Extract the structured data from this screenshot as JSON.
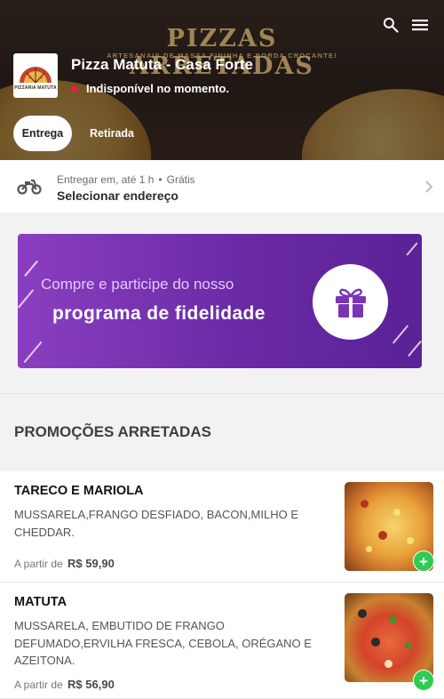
{
  "hero": {
    "brand": "PIZZAS ARRETADAS",
    "tagline": "ARTESANAIS DE MASSA FININHA E BORDA CROCANTE!"
  },
  "store": {
    "logo_text": "PIZZARIA MATUTA",
    "name": "Pizza Matuta - Casa Forte",
    "status": "Indisponível no momento."
  },
  "tabs": [
    {
      "label": "Entrega",
      "active": true
    },
    {
      "label": "Retirada",
      "active": false
    }
  ],
  "delivery": {
    "line1": "Entregar em, até 1 h",
    "separator": "•",
    "fee": "Grátis",
    "address_action": "Selecionar endereço"
  },
  "banner": {
    "line1": "Compre e participe do nosso",
    "line2": "programa de fidelidade"
  },
  "section": {
    "title": "PROMOÇÕES ARRETADAS"
  },
  "products": [
    {
      "name": "TARECO E MARIOLA",
      "description": "MUSSARELA,FRANGO DESFIADO, BACON,MILHO E CHEDDAR.",
      "price_prefix": "A partir de",
      "price": "R$ 59,90"
    },
    {
      "name": "MATUTA",
      "description": "MUSSARELA, EMBUTIDO DE FRANGO DEFUMADO,ERVILHA FRESCA, CEBOLA, ORÉGANO E AZEITONA.",
      "price_prefix": "A partir de",
      "price": "R$ 56,90"
    }
  ],
  "colors": {
    "status_dot": "#e0243c",
    "banner_purple": "#7a34b5",
    "add_green": "#2ecc52"
  },
  "icons": {
    "search": "search-icon",
    "menu": "hamburger-menu-icon",
    "motorcycle": "motorcycle-icon",
    "chevron": "chevron-right-icon",
    "gift": "gift-icon",
    "add": "plus-icon"
  },
  "add_symbol": "+"
}
